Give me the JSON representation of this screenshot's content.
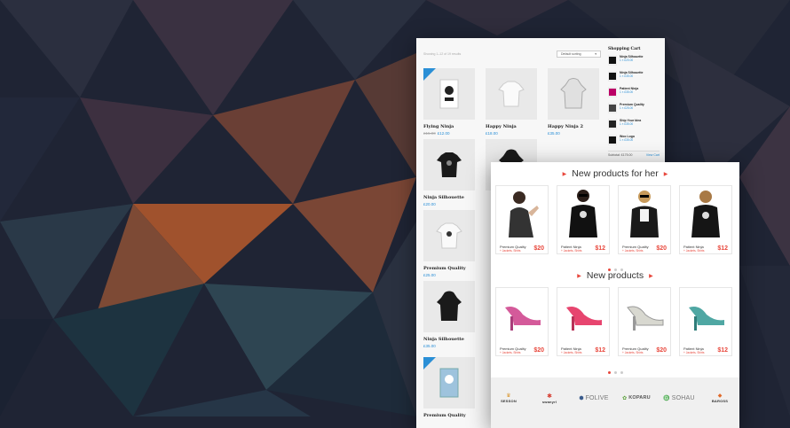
{
  "background": {
    "base_color": "#1f2434",
    "accent_color": "#a0522d"
  },
  "shop": {
    "result_count": "Showing 1–12 of 19 results",
    "sort_label": "Default sorting",
    "products": [
      {
        "name": "Flying Ninja",
        "old_price": "£15.00",
        "price": "£12.00",
        "sale": true,
        "item": "poster"
      },
      {
        "name": "Happy Ninja",
        "price": "£18.00",
        "item": "tshirt-white"
      },
      {
        "name": "Happy Ninja 2",
        "price": "£35.00",
        "item": "hoodie-grey"
      },
      {
        "name": "Ninja Silhouette",
        "price": "£20.00",
        "item": "tshirt-black"
      },
      {
        "name": "Premium Quality",
        "price": "£25.00",
        "item": "tshirt-white"
      },
      {
        "name": "Ninja Silhouette",
        "price": "£35.00",
        "item": "hoodie-black"
      },
      {
        "name": "Premium Quality",
        "price": "",
        "sale": true,
        "item": "poster"
      }
    ],
    "cart": {
      "title": "Shopping Cart",
      "items": [
        {
          "name": "Ninja Silhouette",
          "price": "1 × £20.00"
        },
        {
          "name": "Ninja Silhouette",
          "price": "1 × £35.00"
        },
        {
          "name": "Patient Ninja",
          "price": "1 × £35.00"
        },
        {
          "name": "Premium Quality",
          "price": "1 × £25.00"
        },
        {
          "name": "Ship Your Idea",
          "price": "1 × £35.00"
        },
        {
          "name": "Woo Logo",
          "price": "1 × £35.00"
        }
      ],
      "subtotal_label": "Subtotal: £175.00",
      "view_cart": "View Cart"
    }
  },
  "front": {
    "section1_title": "New products for her",
    "section2_title": "New products",
    "her_products": [
      {
        "name": "Premium Quality",
        "link": "+ Jackets, Shirts",
        "price": "$20"
      },
      {
        "name": "Patient Ninja",
        "link": "+ Jackets, Shirts",
        "price": "$12"
      },
      {
        "name": "Premium Quality",
        "link": "+ Jackets, Shirts",
        "price": "$20"
      },
      {
        "name": "Patient Ninja",
        "link": "+ Jackets, Shirts",
        "price": "$12"
      }
    ],
    "new_products": [
      {
        "name": "Premium Quality",
        "link": "+ Jackets, Shirts",
        "price": "$20"
      },
      {
        "name": "Patient Ninja",
        "link": "+ Jackets, Shirts",
        "price": "$12"
      },
      {
        "name": "Premium Quality",
        "link": "+ Jackets, Shirts",
        "price": "$20"
      },
      {
        "name": "Patient Ninja",
        "link": "+ Jackets, Shirts",
        "price": "$12"
      }
    ],
    "brands": [
      "SESSON",
      "swanyrl",
      "FOLIVE",
      "KOPARU",
      "SOHAU",
      "BAROSS"
    ]
  }
}
